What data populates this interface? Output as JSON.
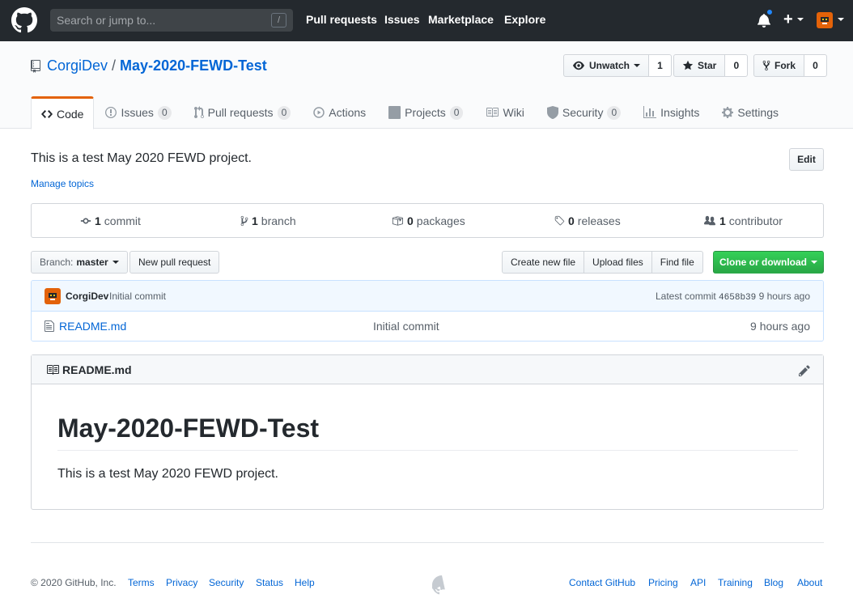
{
  "header": {
    "search_placeholder": "Search or jump to...",
    "slash_key": "/",
    "nav": [
      "Pull requests",
      "Issues",
      "Marketplace",
      "Explore"
    ],
    "plus": "+"
  },
  "repo": {
    "owner": "CorgiDev",
    "separator": "/",
    "name": "May-2020-FEWD-Test",
    "watch_label": "Unwatch",
    "watch_count": "1",
    "star_label": "Star",
    "star_count": "0",
    "fork_label": "Fork",
    "fork_count": "0"
  },
  "tabs": [
    {
      "label": "Code",
      "count": null
    },
    {
      "label": "Issues",
      "count": "0"
    },
    {
      "label": "Pull requests",
      "count": "0"
    },
    {
      "label": "Actions",
      "count": null
    },
    {
      "label": "Projects",
      "count": "0"
    },
    {
      "label": "Wiki",
      "count": null
    },
    {
      "label": "Security",
      "count": "0"
    },
    {
      "label": "Insights",
      "count": null
    },
    {
      "label": "Settings",
      "count": null
    }
  ],
  "description": "This is a test May 2020 FEWD project.",
  "manage_topics": "Manage topics",
  "edit_label": "Edit",
  "summary": {
    "commits_n": "1",
    "commits_label": "commit",
    "branches_n": "1",
    "branches_label": "branch",
    "packages_n": "0",
    "packages_label": "packages",
    "releases_n": "0",
    "releases_label": "releases",
    "contributors_n": "1",
    "contributors_label": "contributor"
  },
  "filenav": {
    "branch_prefix": "Branch:",
    "branch": "master",
    "new_pr": "New pull request",
    "create_file": "Create new file",
    "upload_files": "Upload files",
    "find_file": "Find file",
    "clone": "Clone or download"
  },
  "commit": {
    "author": "CorgiDev",
    "message": "Initial commit",
    "latest_label": "Latest commit",
    "sha": "4658b39",
    "age": "9 hours ago"
  },
  "files": [
    {
      "name": "README.md",
      "message": "Initial commit",
      "age": "9 hours ago"
    }
  ],
  "readme": {
    "filename": "README.md",
    "heading": "May-2020-FEWD-Test",
    "body": "This is a test May 2020 FEWD project."
  },
  "footer": {
    "copyright": "© 2020 GitHub, Inc.",
    "left_links": [
      "Terms",
      "Privacy",
      "Security",
      "Status",
      "Help"
    ],
    "right_links": [
      "Contact GitHub",
      "Pricing",
      "API",
      "Training",
      "Blog",
      "About"
    ]
  },
  "colors": {
    "header_bg": "#24292e",
    "accent_tab": "#e36209",
    "link": "#0366d6",
    "clone_green": "#28a745",
    "notification_dot": "#2188ff"
  },
  "icons": [
    "github-logo-icon",
    "bell-icon",
    "plus-icon",
    "avatar",
    "repo-icon",
    "eye-icon",
    "star-icon",
    "fork-icon",
    "code-icon",
    "issue-icon",
    "pull-request-icon",
    "play-icon",
    "project-icon",
    "book-icon",
    "shield-icon",
    "graph-icon",
    "gear-icon",
    "commit-icon",
    "branch-icon",
    "package-icon",
    "tag-icon",
    "people-icon",
    "file-icon",
    "pencil-icon"
  ]
}
